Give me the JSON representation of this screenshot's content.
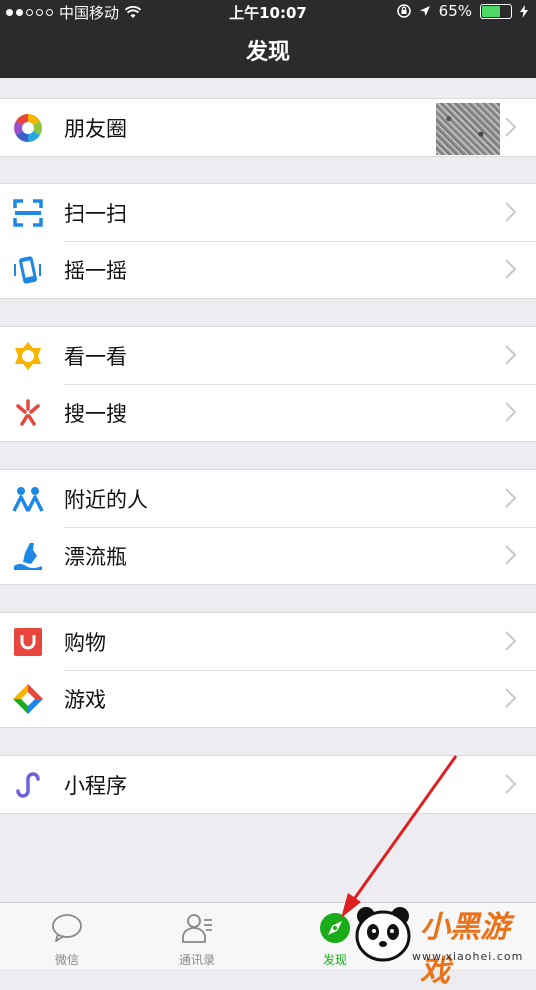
{
  "status_bar": {
    "carrier": "中国移动",
    "time": "上午10:07",
    "battery": "65%",
    "battery_level": 0.65
  },
  "nav": {
    "title": "发现"
  },
  "groups": [
    {
      "items": [
        {
          "label": "朋友圈",
          "icon": "moments-icon",
          "thumbnail": true
        }
      ]
    },
    {
      "items": [
        {
          "label": "扫一扫",
          "icon": "scan-icon"
        },
        {
          "label": "摇一摇",
          "icon": "shake-icon"
        }
      ]
    },
    {
      "items": [
        {
          "label": "看一看",
          "icon": "top-stories-icon"
        },
        {
          "label": "搜一搜",
          "icon": "search-icon"
        }
      ]
    },
    {
      "items": [
        {
          "label": "附近的人",
          "icon": "people-nearby-icon"
        },
        {
          "label": "漂流瓶",
          "icon": "message-bottle-icon"
        }
      ]
    },
    {
      "items": [
        {
          "label": "购物",
          "icon": "shopping-icon"
        },
        {
          "label": "游戏",
          "icon": "games-icon"
        }
      ]
    },
    {
      "items": [
        {
          "label": "小程序",
          "icon": "mini-programs-icon"
        }
      ]
    }
  ],
  "tab_bar": {
    "tabs": [
      {
        "label": "微信",
        "icon": "chat-bubble-icon"
      },
      {
        "label": "通讯录",
        "icon": "contacts-icon"
      },
      {
        "label": "发现",
        "icon": "compass-icon",
        "active": true
      }
    ]
  },
  "watermark": {
    "brand": "小黑游戏",
    "url": "www.xiaohei.com"
  },
  "colors": {
    "header_bg": "#2b2b2d",
    "accent": "#1aad19",
    "page_bg": "#ececf1"
  }
}
